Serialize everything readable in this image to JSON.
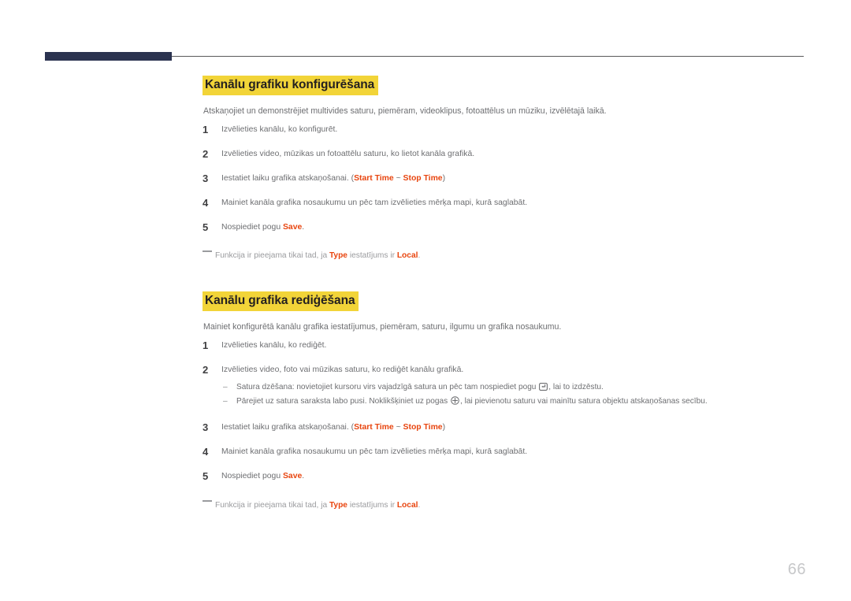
{
  "page": {
    "number": "66"
  },
  "sections": [
    {
      "heading": "Kanālu grafiku konfigurēšana",
      "intro": "Atskaņojiet un demonstrējiet multivides saturu, piemēram, videoklipus, fotoattēlus un mūziku, izvēlētajā laikā.",
      "steps": [
        {
          "num": "1",
          "text": "Izvēlieties kanālu, ko konfigurēt."
        },
        {
          "num": "2",
          "text": "Izvēlieties video, mūzikas un fotoattēlu saturu, ko lietot kanāla grafikā."
        },
        {
          "num": "3",
          "text_before": "Iestatiet laiku grafika atskaņošanai. (",
          "term_1": "Start Time",
          "text_mid": " ~ ",
          "term_2": "Stop Time",
          "text_after": ")"
        },
        {
          "num": "4",
          "text": "Mainiet kanāla grafika nosaukumu un pēc tam izvēlieties mērķa mapi, kurā saglabāt."
        },
        {
          "num": "5",
          "text_before": "Nospiediet pogu ",
          "term_1": "Save",
          "text_after": "."
        }
      ],
      "note": {
        "text_before": "Funkcija ir pieejama tikai tad, ja ",
        "term_1": "Type",
        "text_mid": " iestatījums ir ",
        "term_2": "Local",
        "text_after": "."
      }
    },
    {
      "heading": "Kanālu grafika rediģēšana",
      "intro": "Mainiet konfigurētā kanālu grafika iestatījumus, piemēram, saturu, ilgumu un grafika nosaukumu.",
      "steps": [
        {
          "num": "1",
          "text": "Izvēlieties kanālu, ko rediģēt."
        },
        {
          "num": "2",
          "text": "Izvēlieties video, foto vai mūzikas saturu, ko rediģēt kanālu grafikā.",
          "subs": [
            {
              "dash": "–",
              "text_before": "Satura dzēšana: novietojiet kursoru virs vajadzīgā satura un pēc tam nospiediet pogu ",
              "icon": "enter-key-icon",
              "text_after": ", lai to izdzēstu."
            },
            {
              "dash": "–",
              "text_before": "Pārejiet uz satura saraksta labo pusi. Noklikšķiniet uz pogas ",
              "icon": "plus-circle-icon",
              "text_after": ", lai pievienotu saturu vai mainītu satura objektu atskaņošanas secību."
            }
          ]
        },
        {
          "num": "3",
          "text_before": "Iestatiet laiku grafika atskaņošanai. (",
          "term_1": "Start Time",
          "text_mid": " ~ ",
          "term_2": "Stop Time",
          "text_after": ")"
        },
        {
          "num": "4",
          "text": "Mainiet kanāla grafika nosaukumu un pēc tam izvēlieties mērķa mapi, kurā saglabāt."
        },
        {
          "num": "5",
          "text_before": "Nospiediet pogu ",
          "term_1": "Save",
          "text_after": "."
        }
      ],
      "note": {
        "text_before": "Funkcija ir pieejama tikai tad, ja ",
        "term_1": "Type",
        "text_mid": " iestatījums ir ",
        "term_2": "Local",
        "text_after": "."
      }
    }
  ],
  "colors": {
    "accent_orange": "#e8450f",
    "highlight_yellow": "#f2d438",
    "header_navy": "#2b3350",
    "body_text": "#6d6e71"
  }
}
